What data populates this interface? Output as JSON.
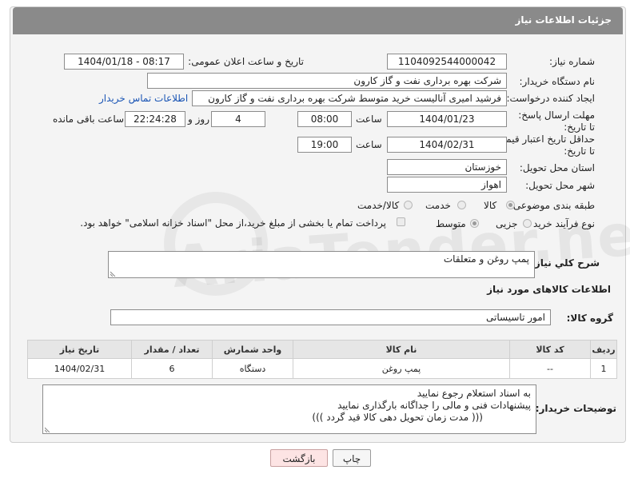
{
  "header": {
    "title": "جزئیات اطلاعات نیاز"
  },
  "watermark": {
    "text": "AriaTender.neT"
  },
  "form": {
    "need_number": {
      "label": "شماره نیاز:",
      "value": "1104092544000042"
    },
    "announce": {
      "label": "تاریخ و ساعت اعلان عمومی:",
      "value": "1404/01/18 - 08:17"
    },
    "buyer_org": {
      "label": "نام دستگاه خریدار:",
      "value": "شرکت بهره برداری نفت و گاز کارون"
    },
    "requester": {
      "label": "ایجاد کننده درخواست:",
      "value": "فرشید امیری آنالیست خرید متوسط شرکت بهره برداری نفت و گاز کارون",
      "contact_link": "اطلاعات تماس خریدار"
    },
    "reply_deadline": {
      "label": "مهلت ارسال پاسخ: تا تاریخ:",
      "date": "1404/01/23",
      "time_label": "ساعت",
      "time": "08:00",
      "days": "4",
      "days_label": "روز و",
      "remaining": "22:24:28",
      "remaining_label": "ساعت باقی مانده"
    },
    "price_validity": {
      "label": "حداقل تاریخ اعتبار قیمت: تا تاریخ:",
      "date": "1404/02/31",
      "time_label": "ساعت",
      "time": "19:00"
    },
    "province": {
      "label": "استان محل تحویل:",
      "value": "خوزستان"
    },
    "city": {
      "label": "شهر محل تحویل:",
      "value": "اهواز"
    },
    "category": {
      "label": "طبقه بندی موضوعی:",
      "options": [
        "کالا",
        "خدمت",
        "کالا/خدمت"
      ]
    },
    "process": {
      "label": "نوع فرآیند خرید :",
      "options": [
        "جزیی",
        "متوسط"
      ],
      "note": "پرداخت تمام یا بخشی از مبلغ خرید،از محل \"اسناد خزانه اسلامی\" خواهد بود."
    },
    "description": {
      "label": "شرح كلي نياز:",
      "value": "پمپ روغن و متعلقات"
    }
  },
  "goods": {
    "section_title": "اطلاعات کالاهای مورد نیاز",
    "group_label": "گروه کالا:",
    "group_value": "امور تاسیساتی",
    "columns": [
      "ردیف",
      "کد کالا",
      "نام کالا",
      "واحد شمارش",
      "تعداد / مقدار",
      "تاریخ نیاز"
    ],
    "rows": [
      [
        "1",
        "--",
        "پمپ روغن",
        "دستگاه",
        "6",
        "1404/02/31"
      ]
    ]
  },
  "buyer_notes": {
    "label": "توضیحات خریدار:",
    "lines": [
      "به اسناد استعلام رجوع نمایید",
      "پیشنهادات فنی و مالی را جداگانه بارگذاری نمایید",
      "((( مدت زمان تحویل دهی کالا قید گردد )))"
    ]
  },
  "buttons": {
    "print": "چاپ",
    "back": "بازگشت"
  }
}
